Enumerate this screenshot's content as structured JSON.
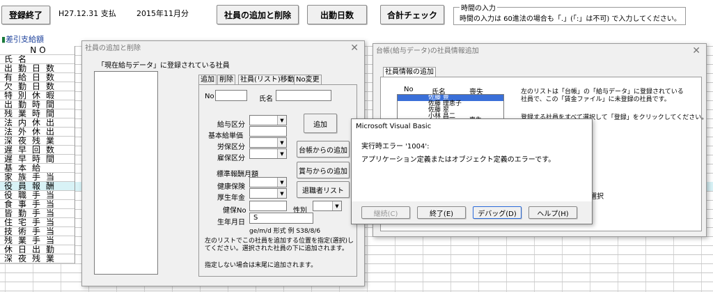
{
  "toolbar": {
    "end_button": "登録終了",
    "date_text": "H27.12.31  支払",
    "month_text": "2015年11月分",
    "add_delete_button": "社員の追加と削除",
    "attendance_button": "出勤日数",
    "total_check_button": "合計チェック",
    "time_input_title": "時間の入力",
    "time_input_note": "時間の入力は 60進法の場合も「.」(「:」は不可) で入力してください。",
    "sheet_link": "差引支給額"
  },
  "sheet": {
    "rows": [
      "NO",
      "氏名",
      "出勤日数",
      "有給日数",
      "欠勤日数",
      "特別休暇",
      "出勤時間",
      "残業時間",
      "法内休出",
      "法外休出",
      "深夜残業",
      "遅早回数",
      "遅早時間",
      "基本給",
      "家族手当",
      "役員報酬",
      "役職手当",
      "食事手当",
      "皆勤手当",
      "住宅手当",
      "技術手当",
      "残業手当",
      "休日出勤",
      "深夜残業"
    ]
  },
  "add_dialog": {
    "title": "社員の追加と削除",
    "list_caption": "「現在給与データ」に登録されている社員",
    "tabs": [
      "追加",
      "削除",
      "社員(リスト)移動",
      "No変更"
    ],
    "no_label": "No",
    "name_label": "氏名",
    "pay_type_label": "給与区分",
    "base_pay_label": "基本給単価",
    "labor_ins_label": "労保区分",
    "employ_ins_label": "雇保区分",
    "std_label": "標準報酬月額",
    "health_label": "健康保険",
    "pension_label": "厚生年金",
    "health_no_label": "健保No",
    "gender_label": "性別",
    "birth_label": "生年月日",
    "birth_value": "S",
    "birth_format": "ge/m/d 形式 例 S38/8/6",
    "add_button": "追加",
    "from_ledger_button": "台帳からの追加",
    "from_bonus_button": "賞与からの追加",
    "retired_button": "退職者リスト",
    "help1": "左のリストでこの社員を追加する位置を指定(選択)してください。選択された社員の下に追加されます。",
    "help2": "指定しない場合は末尾に追加されます。"
  },
  "ledger_dialog": {
    "title": "台帳(給与データ)の社員情報追加",
    "tab": "社員情報の追加",
    "col_no": "No",
    "col_name": "氏名",
    "col_lost": "喪失",
    "employees": [
      "佐藤 豊",
      "佐藤 理恵子",
      "佐藤 翠",
      "小林 昌二"
    ],
    "extra_lost": "喪失",
    "desc1": "左のリストは「台帳」の「給与データ」に登録されている社員で、この「賃金ファイル」に未登録の社員です。",
    "desc2": "登録する社員をすべて選択して「登録」をクリックしてください。",
    "select_fragment": "選択"
  },
  "error_dialog": {
    "title": "Microsoft Visual Basic",
    "error_code": "実行時エラー '1004':",
    "message": "アプリケーション定義またはオブジェクト定義のエラーです。",
    "continue": "継続(C)",
    "end": "終了(E)",
    "debug": "デバッグ(D)",
    "help": "ヘルプ(H)"
  }
}
